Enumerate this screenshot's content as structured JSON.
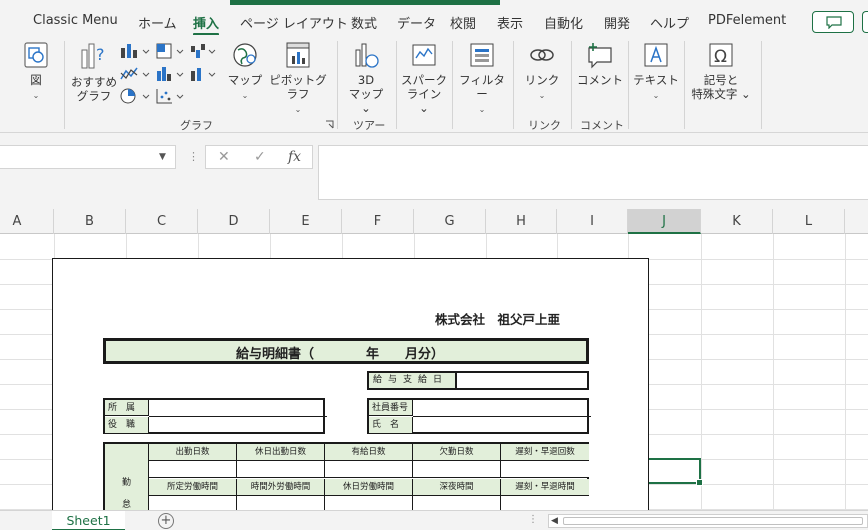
{
  "colors": {
    "accent": "#1e7145",
    "header_fill": "#e2efda",
    "ribbon_bg": "#f3f3f3"
  },
  "menu": {
    "tabs": [
      {
        "label": "Classic Menu"
      },
      {
        "label": "ホーム"
      },
      {
        "label": "挿入",
        "active": true
      },
      {
        "label": "ページ レイアウト"
      },
      {
        "label": "数式"
      },
      {
        "label": "データ"
      },
      {
        "label": "校閲"
      },
      {
        "label": "表示"
      },
      {
        "label": "自動化"
      },
      {
        "label": "開発"
      },
      {
        "label": "ヘルプ"
      },
      {
        "label": "PDFelement"
      }
    ],
    "comment_icon": "comment-bubble-icon"
  },
  "ribbon": {
    "illustrations": {
      "label_line1": "図",
      "chevron": "⌄"
    },
    "recommended_charts": {
      "line1": "おすすめ",
      "line2": "グラフ"
    },
    "maps": {
      "line1": "マップ",
      "chevron": "⌄"
    },
    "pivot_chart": {
      "line1": "ピボットグラフ",
      "chevron": "⌄"
    },
    "charts_group_label": "グラフ",
    "map3d": {
      "line1": "3D",
      "line2": "マップ ⌄"
    },
    "tours_group_label": "ツアー",
    "sparklines": {
      "line1": "スパーク",
      "line2": "ライン ⌄"
    },
    "filters": {
      "line1": "フィルター",
      "chevron": "⌄"
    },
    "link": {
      "line1": "リンク",
      "chevron": "⌄"
    },
    "links_group_label": "リンク",
    "comment": {
      "line1": "コメント"
    },
    "comments_group_label": "コメント",
    "text": {
      "line1": "テキスト",
      "chevron": "⌄"
    },
    "symbols": {
      "line1": "記号と",
      "line2": "特殊文字 ⌄"
    }
  },
  "formula_bar": {
    "name_box_value": "",
    "cancel_icon": "✕",
    "enter_icon": "✓",
    "function_label": "fx",
    "formula_value": ""
  },
  "grid": {
    "columns": [
      "A",
      "B",
      "C",
      "D",
      "E",
      "F",
      "G",
      "H",
      "I",
      "J",
      "K",
      "L"
    ],
    "selected_column": "J"
  },
  "payslip": {
    "company": "株式会社　祖父戸上亜",
    "title": "給与明細書（　　　　年　　月分）",
    "pay_date_label": "給与支給日",
    "dept_label": "所属",
    "position_label": "役職",
    "employee_no_label": "社員番号",
    "name_label": "氏名",
    "side_label_1": "勤",
    "side_label_2": "怠",
    "row1_headers": [
      "出勤日数",
      "休日出勤日数",
      "有給日数",
      "欠勤日数",
      "遅刻・早退回数"
    ],
    "row2_headers": [
      "所定労働時間",
      "時間外労働時間",
      "休日労働時間",
      "深夜時間",
      "遅刻・早退時間"
    ]
  },
  "sheets": {
    "tabs": [
      "Sheet1"
    ],
    "add_label": "+"
  }
}
